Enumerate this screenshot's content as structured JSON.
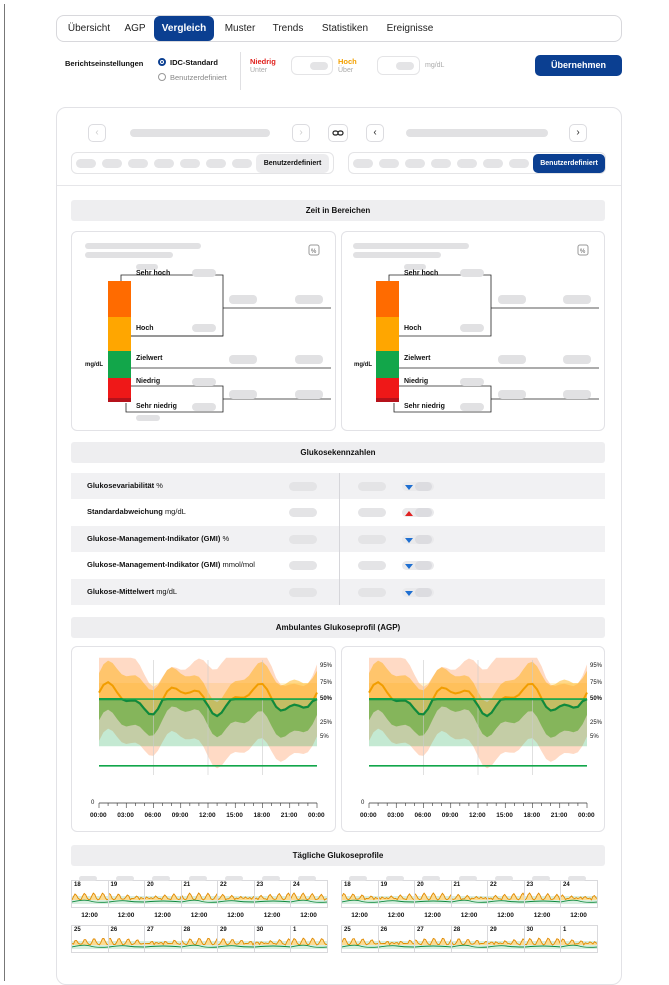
{
  "tabs": [
    {
      "label": "Übersicht"
    },
    {
      "label": "AGP"
    },
    {
      "label": "Vergleich",
      "active": true
    },
    {
      "label": "Muster"
    },
    {
      "label": "Trends"
    },
    {
      "label": "Statistiken"
    },
    {
      "label": "Ereignisse"
    }
  ],
  "settings": {
    "title": "Berichtseinstellungen",
    "option_standard": "IDC-Standard",
    "option_custom": "Benutzerdefiniert",
    "low_label": "Niedrig",
    "low_sub": "Unter",
    "high_label": "Hoch",
    "high_sub": "Über",
    "unit": "mg/dL",
    "apply_label": "Übernehmen"
  },
  "compare": {
    "left_custom_label": "Benutzerdefiniert",
    "right_custom_label": "Benutzerdefiniert"
  },
  "time_in_range": {
    "title": "Zeit in Bereichen",
    "unit": "mg/dL",
    "percent_icon": "%",
    "labels": {
      "very_high": "Sehr hoch",
      "high": "Hoch",
      "target": "Zielwert",
      "low": "Niedrig",
      "very_low": "Sehr niedrig"
    },
    "colors": {
      "very_high": "#ff6b00",
      "high": "#ffa600",
      "target": "#12a64a",
      "low": "#ef1818",
      "very_low": "#b5121b"
    }
  },
  "metrics": {
    "title": "Glukosekennzahlen",
    "rows": [
      {
        "name": "Glukosevariabilität",
        "unit": "%",
        "trend": "down"
      },
      {
        "name": "Standardabweichung",
        "unit": "mg/dL",
        "trend": "up"
      },
      {
        "name": "Glukose-Management-Indikator (GMI)",
        "unit": "%",
        "trend": "down"
      },
      {
        "name": "Glukose-Management-Indikator (GMI)",
        "unit": "mmol/mol",
        "trend": "down"
      },
      {
        "name": "Glukose-Mittelwert",
        "unit": "mg/dL",
        "trend": "down"
      }
    ]
  },
  "agp": {
    "title": "Ambulantes Glukoseprofil (AGP)",
    "percentiles": [
      "95%",
      "75%",
      "50%",
      "25%",
      "5%"
    ],
    "zero": "0",
    "x_ticks": [
      "00:00",
      "03:00",
      "06:00",
      "09:00",
      "12:00",
      "15:00",
      "18:00",
      "21:00",
      "00:00"
    ]
  },
  "daily": {
    "title": "Tägliche Glukoseprofile",
    "week1": [
      "18",
      "19",
      "20",
      "21",
      "22",
      "23",
      "24"
    ],
    "week2": [
      "25",
      "26",
      "27",
      "28",
      "29",
      "30",
      "1"
    ],
    "noon": "12:00"
  }
}
